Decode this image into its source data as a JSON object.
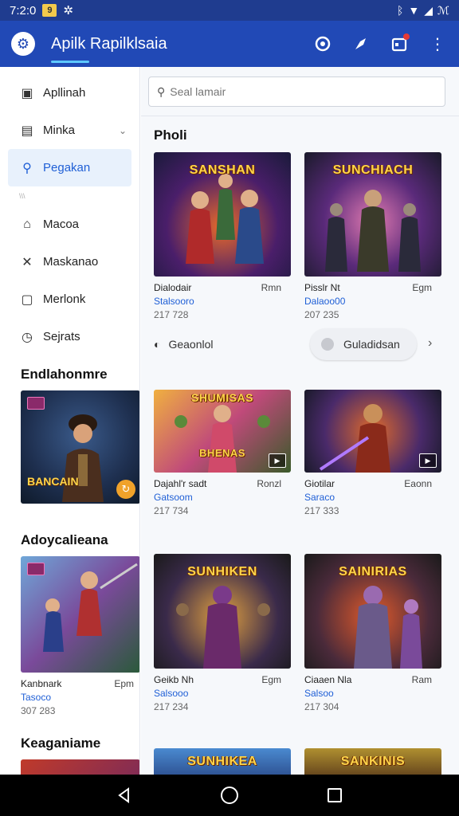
{
  "status_bar": {
    "time": "7:2:0",
    "badge": "9",
    "signal": "A",
    "right_text": "ℳ"
  },
  "app_bar": {
    "title": "Apilk Rapilklsaia",
    "logo_icon": "gear-icon",
    "actions": [
      "lock-icon",
      "pin-icon",
      "calendar-icon",
      "more-icon"
    ]
  },
  "sidebar": {
    "items": [
      {
        "label": "Apllinah",
        "icon": "image-icon"
      },
      {
        "label": "Minka",
        "icon": "calendar-icon",
        "chevron": true
      },
      {
        "label": "Pegakan",
        "icon": "person-icon",
        "active": true
      },
      {
        "label": "Macoa",
        "icon": "home-icon"
      },
      {
        "label": "Maskanao",
        "icon": "tool-icon"
      },
      {
        "label": "Merlonk",
        "icon": "list-icon"
      },
      {
        "label": "Sejrats",
        "icon": "clock-icon"
      }
    ],
    "separator": "\\\\\\",
    "section1_heading": "Endlahonmre",
    "card1_text": "BANCAIN",
    "section2_heading": "Adoycalieana",
    "card2_meta": {
      "name": "Kanbnark",
      "right": "Epm",
      "sub": "Tasoco",
      "num": "307 283"
    },
    "section3_heading": "Keaganiame"
  },
  "search": {
    "placeholder": "Seal lamair"
  },
  "main": {
    "section_title": "Pholi",
    "filter_label": "Geaonlol",
    "chip_label": "Guladidsan",
    "games": [
      {
        "thumb_title": "SANSHAN",
        "name": "Dialodair",
        "right": "Rmn",
        "sub": "Stalsooro",
        "num": "217 728"
      },
      {
        "thumb_title": "SUNCHIACH",
        "name": "Pisslr Nt",
        "right": "Egm",
        "sub": "Dalaoo00",
        "num": "207 235"
      },
      {
        "thumb_title": "SHUMISAS",
        "name": "Dajahl'r sadt",
        "right": "Ronzl",
        "sub": "Gatsoom",
        "num": "217 734",
        "sub_label": "BHENAS"
      },
      {
        "thumb_title": "",
        "name": "Giotilar",
        "right": "Eaonn",
        "sub": "Saraco",
        "num": "217 333"
      },
      {
        "thumb_title": "SUNHIKEN",
        "name": "Geikb Nh",
        "right": "Egm",
        "sub": "Salsooo",
        "num": "217 234"
      },
      {
        "thumb_title": "SAINIRIAS",
        "name": "Ciaaen Nla",
        "right": "Ram",
        "sub": "Salsoo",
        "num": "217 304"
      },
      {
        "thumb_title": "SUNHIKEA",
        "name": "",
        "right": "",
        "sub": "",
        "num": ""
      },
      {
        "thumb_title": "SANKINIS",
        "name": "",
        "right": "",
        "sub": "",
        "num": ""
      }
    ]
  },
  "colors": {
    "app_bar": "#2149b6",
    "status_bar": "#1f3c8f",
    "accent": "#1f5fd6"
  }
}
